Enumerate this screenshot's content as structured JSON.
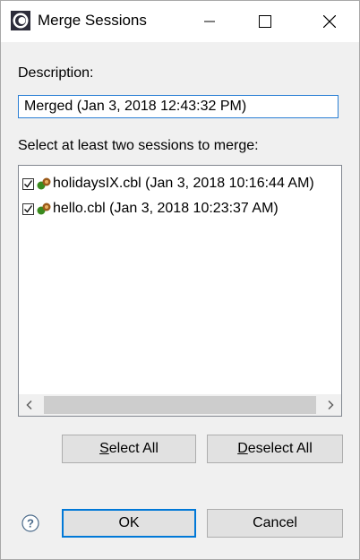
{
  "window": {
    "title": "Merge Sessions",
    "icons": {
      "app": "eclipse-icon",
      "minimize": "minimize-icon",
      "maximize": "maximize-icon",
      "close": "close-icon"
    }
  },
  "description": {
    "label": "Description:",
    "value": "Merged (Jan 3, 2018 12:43:32 PM)"
  },
  "sessions": {
    "label": "Select at least two sessions to merge:",
    "items": [
      {
        "label": "holidaysIX.cbl (Jan 3, 2018 10:16:44 AM)",
        "checked": true,
        "icon": "session-icon"
      },
      {
        "label": "hello.cbl (Jan 3, 2018 10:23:37 AM)",
        "checked": true,
        "icon": "session-icon"
      }
    ],
    "scroll_icons": {
      "left": "chevron-left-icon",
      "right": "chevron-right-icon"
    }
  },
  "buttons": {
    "select_all": {
      "mnemonic": "S",
      "rest": "elect All"
    },
    "deselect_all": {
      "mnemonic": "D",
      "rest": "eselect All"
    },
    "ok": "OK",
    "cancel": "Cancel",
    "help_icon": "help-icon"
  },
  "colors": {
    "accent": "#0078d7",
    "background": "#f0f0f0",
    "icon_green": "#3a8a1e",
    "icon_brown": "#9a5a1a"
  }
}
